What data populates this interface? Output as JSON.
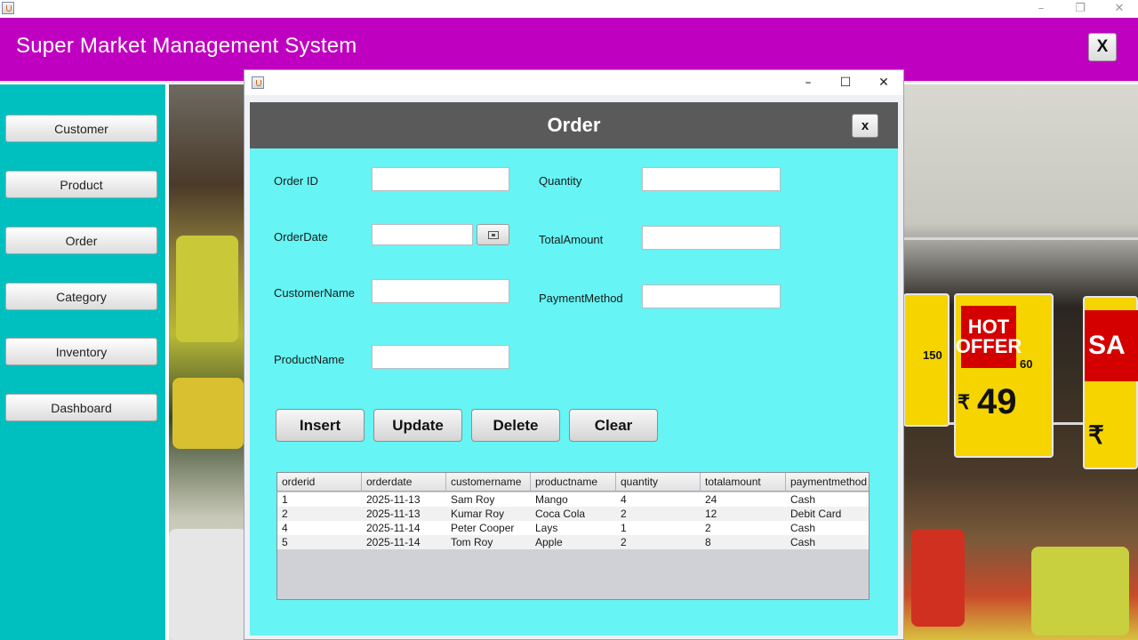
{
  "os_window": {
    "controls": {
      "minimize": "–",
      "maximize": "❐",
      "close": "✕"
    }
  },
  "app": {
    "title": "Super Market Management System",
    "close_label": "X",
    "colors": {
      "header": "#c000c0",
      "sidebar": "#00bfbf",
      "panel": "#66f4f4"
    }
  },
  "sidebar": {
    "items": [
      {
        "label": "Customer"
      },
      {
        "label": "Product"
      },
      {
        "label": "Order"
      },
      {
        "label": "Category"
      },
      {
        "label": "Inventory"
      },
      {
        "label": "Dashboard"
      }
    ]
  },
  "background_photo": {
    "sign_texts": {
      "hot_offer": "HOT OFFER",
      "price_49": "49",
      "price_60": "60",
      "price_150": "150",
      "sale_partial": "SA",
      "rupee": "₹"
    }
  },
  "order_window": {
    "controls": {
      "minimize": "–",
      "maximize": "☐",
      "close": "✕"
    },
    "title": "Order",
    "close_label": "x",
    "fields": {
      "order_id": {
        "label": "Order ID",
        "value": ""
      },
      "order_date": {
        "label": "OrderDate",
        "value": ""
      },
      "customer_name": {
        "label": "CustomerName",
        "value": ""
      },
      "product_name": {
        "label": "ProductName",
        "value": ""
      },
      "quantity": {
        "label": "Quantity",
        "value": ""
      },
      "total_amount": {
        "label": "TotalAmount",
        "value": ""
      },
      "payment_method": {
        "label": "PaymentMethod",
        "value": ""
      }
    },
    "buttons": {
      "insert": "Insert",
      "update": "Update",
      "delete": "Delete",
      "clear": "Clear"
    },
    "table": {
      "columns": [
        "orderid",
        "orderdate",
        "customername",
        "productname",
        "quantity",
        "totalamount",
        "paymentmethod"
      ],
      "rows": [
        [
          "1",
          "2025-11-13",
          "Sam Roy",
          "Mango",
          "4",
          "24",
          "Cash"
        ],
        [
          "2",
          "2025-11-13",
          "Kumar Roy",
          "Coca Cola",
          "2",
          "12",
          "Debit Card"
        ],
        [
          "4",
          "2025-11-14",
          "Peter Cooper",
          "Lays",
          "1",
          "2",
          "Cash"
        ],
        [
          "5",
          "2025-11-14",
          "Tom Roy",
          "Apple",
          "2",
          "8",
          "Cash"
        ]
      ]
    }
  }
}
